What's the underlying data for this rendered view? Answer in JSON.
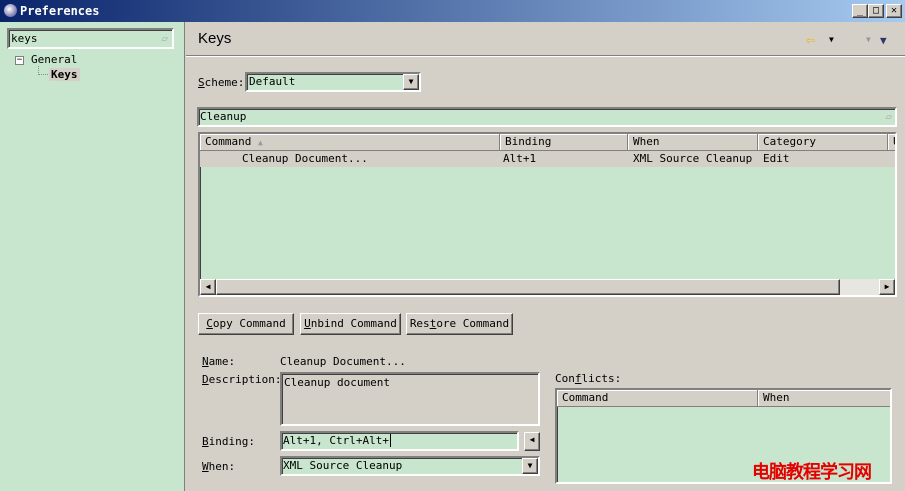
{
  "window": {
    "title": "Preferences",
    "minimize": "_",
    "maximize": "□",
    "close": "✕"
  },
  "sidebar": {
    "filter_value": "keys",
    "tree": [
      {
        "label": "General",
        "expander": "−"
      },
      {
        "label": "Keys"
      }
    ]
  },
  "page": {
    "title": "Keys"
  },
  "scheme": {
    "label_u": "S",
    "label": "cheme:",
    "value": "Default"
  },
  "filter": {
    "value": "Cleanup"
  },
  "table": {
    "columns": [
      "Command",
      "Binding",
      "When",
      "Category",
      "U"
    ],
    "rows": [
      {
        "command": "Cleanup Document...",
        "binding": "Alt+1",
        "when": "XML Source Cleanup",
        "category": "Edit"
      }
    ]
  },
  "buttons": {
    "copy_u": "C",
    "copy": "opy Command",
    "unbind_u": "U",
    "unbind": "nbind Command",
    "restore_a": "Res",
    "restore_u": "t",
    "restore_b": "ore Command"
  },
  "details": {
    "name_u": "N",
    "name_label": "ame:",
    "name_value": "Cleanup Document...",
    "desc_u": "D",
    "desc_label": "escription:",
    "desc_value": "Cleanup document",
    "binding_u": "B",
    "binding_label": "inding:",
    "binding_value": "Alt+1, Ctrl+Alt+",
    "when_u": "W",
    "when_label": "hen:",
    "when_value": "XML Source Cleanup"
  },
  "conflicts": {
    "label_a": "Con",
    "label_u": "f",
    "label_b": "licts:",
    "columns": [
      "Command",
      "When"
    ]
  },
  "watermark": "电脑教程学习网"
}
